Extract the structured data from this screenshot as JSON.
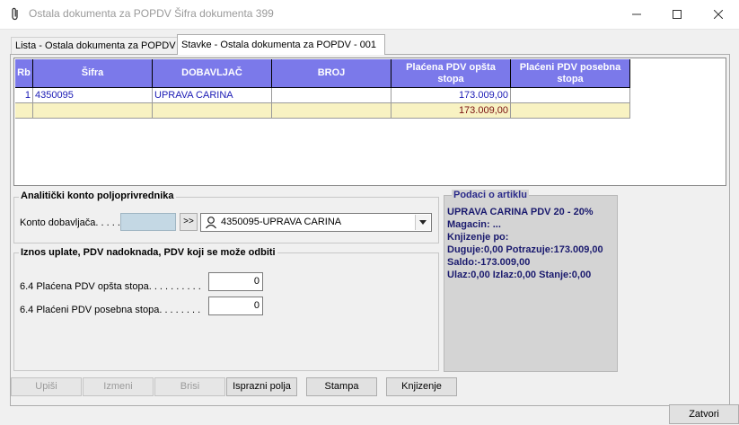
{
  "window": {
    "title": "Ostala dokumenta za POPDV Šifra dokumenta 399",
    "minimize_glyph": "—",
    "maximize_glyph": "☐",
    "close_glyph": "✕"
  },
  "tabs": [
    {
      "label": "Lista - Ostala dokumenta za POPDV",
      "active": false
    },
    {
      "label": "Stavke - Ostala dokumenta za POPDV - 001",
      "active": true
    }
  ],
  "grid": {
    "headers": [
      "Rb",
      "Šifra",
      "DOBAVLJAČ",
      "BROJ",
      "Plaćena PDV opšta stopa",
      "Plaćeni PDV posebna stopa"
    ],
    "rows": [
      [
        "1",
        "4350095",
        "UPRAVA CARINA",
        "",
        "173.009,00",
        ""
      ]
    ],
    "totals": [
      "",
      "",
      "",
      "",
      "173.009,00",
      ""
    ],
    "colors": {
      "header_bg": "#7b79ea",
      "total_bg": "#f8f2c2",
      "row_text": "#1b1bb5"
    }
  },
  "analitika": {
    "title": "Analitički konto poljoprivrednika",
    "konto_label": "Konto dobavljača. . . . .",
    "konto_value": "",
    "lookup_button": ">>",
    "combo_value": "4350095-UPRAVA CARINA",
    "combo_icon": "person-icon"
  },
  "iznos": {
    "title": "Iznos uplate, PDV nadoknada, PDV koji se može odbiti",
    "fields": [
      {
        "label": "6.4 Plaćena PDV opšta stopa. . . . . . . . . .",
        "value": "0"
      },
      {
        "label": "6.4 Plaćeni PDV posebna stopa. . . . . . . .",
        "value": "0"
      }
    ]
  },
  "artikal": {
    "title": "Podaci o artiklu",
    "lines": [
      "UPRAVA CARINA PDV 20 - 20%",
      "Magacin: ...",
      "Knjizenje po:",
      "Duguje:0,00 Potrazuje:173.009,00",
      "Saldo:-173.009,00",
      "Ulaz:0,00 Izlaz:0,00 Stanje:0,00"
    ]
  },
  "buttons": {
    "upisi": "Upiši",
    "izmeni": "Izmeni",
    "brisi": "Brisi",
    "isprazni": "Isprazni polja",
    "stampa": "Stampa",
    "knjizenje": "Knjizenje",
    "zatvori": "Zatvori"
  }
}
